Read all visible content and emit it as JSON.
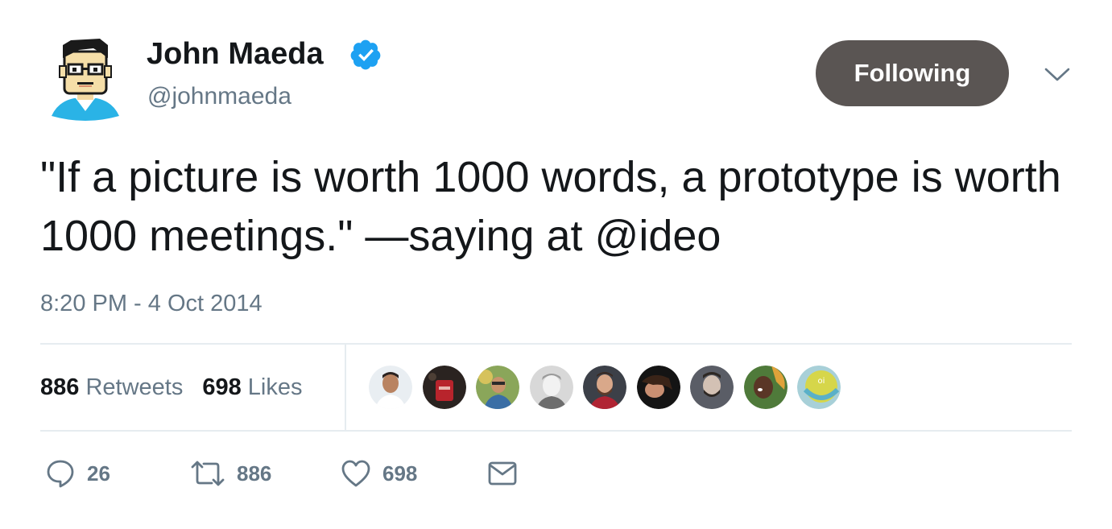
{
  "author": {
    "name": "John Maeda",
    "handle": "@johnmaeda",
    "verified": true
  },
  "follow_button": {
    "label": "Following"
  },
  "tweet": {
    "text": "\"If a picture is worth 1000 words, a prototype is worth 1000 meetings.\" —saying at @ideo",
    "timestamp": "8:20 PM - 4 Oct 2014"
  },
  "stats": {
    "retweets_count": "886",
    "retweets_label": "Retweets",
    "likes_count": "698",
    "likes_label": "Likes"
  },
  "actions": {
    "reply_count": "26",
    "retweet_count": "886",
    "like_count": "698"
  },
  "colors": {
    "text": "#14171a",
    "secondary": "#657786",
    "verified": "#1da1f2",
    "button": "#5a5553",
    "divider": "#e6ecf0"
  }
}
